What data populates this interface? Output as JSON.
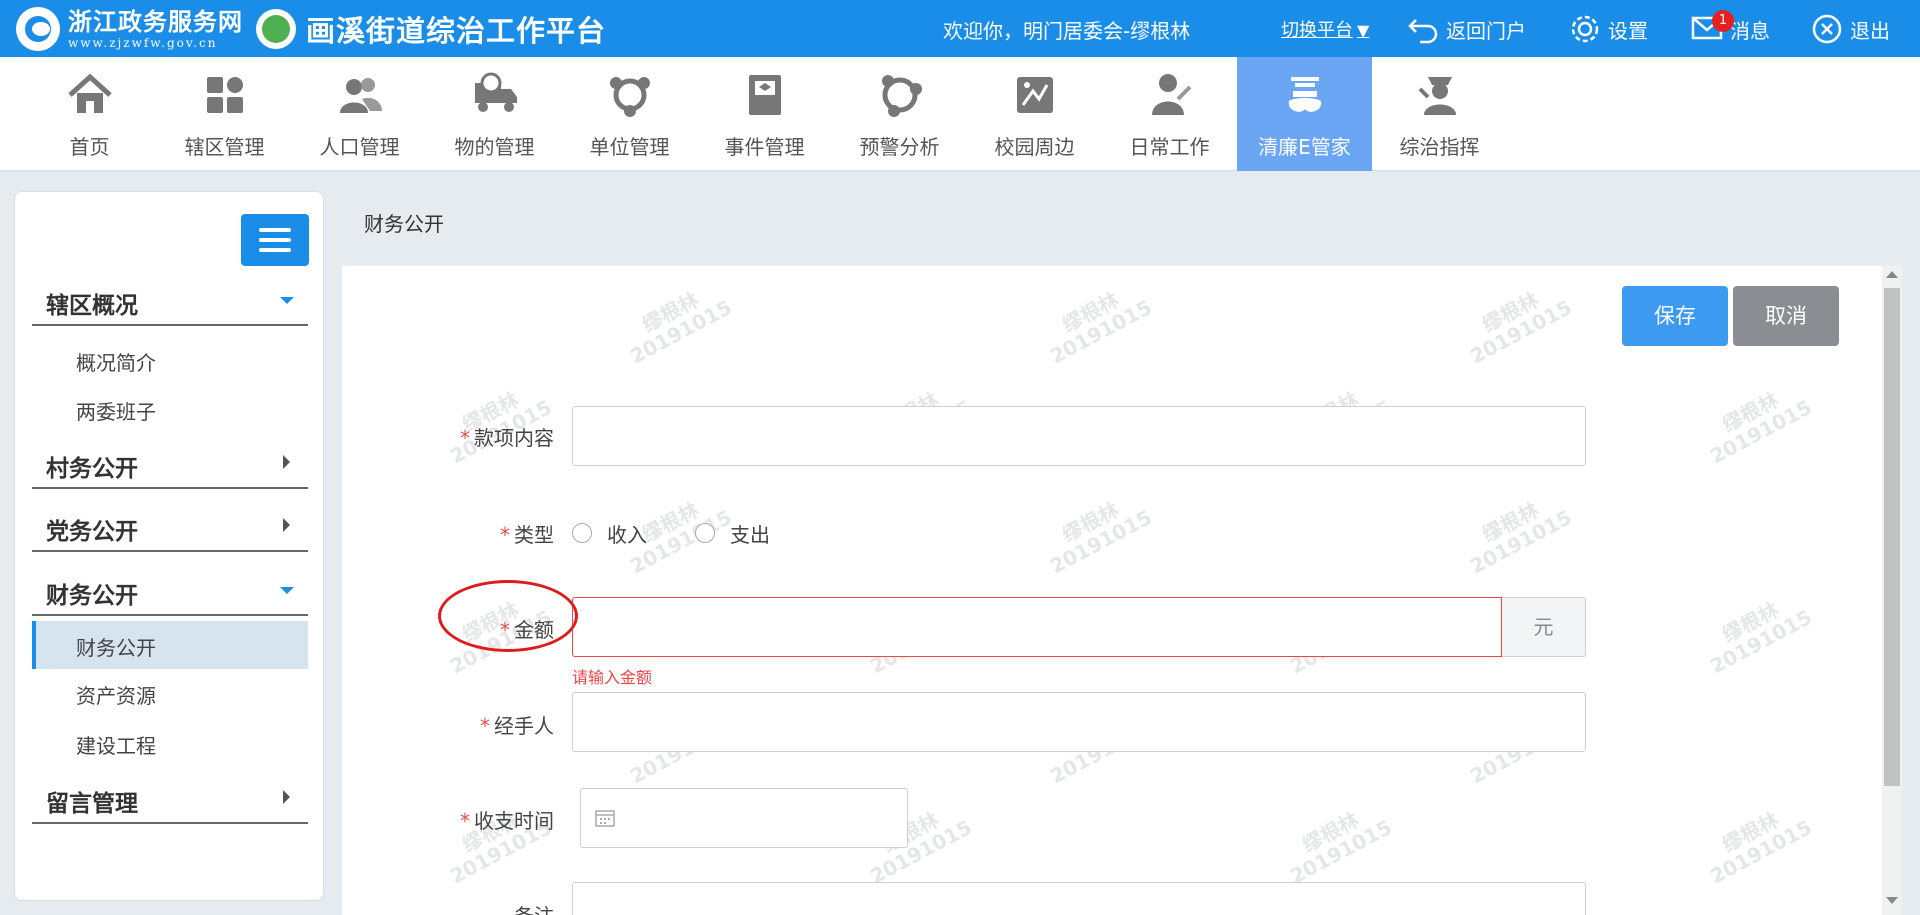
{
  "header": {
    "portal_name": "浙江政务服务网",
    "portal_url": "www.zjzwfw.gov.cn",
    "platform_title": "画溪街道综治工作平台",
    "welcome": "欢迎你，明门居委会-缪根林",
    "switch_platform": "切换平台",
    "switch_arrow": "▼",
    "return_portal": "返回门户",
    "settings": "设置",
    "messages": "消息",
    "message_count": "1",
    "logout": "退出",
    "color": "#1a8de9"
  },
  "nav": {
    "items": [
      {
        "label": "首页",
        "icon": "home-icon"
      },
      {
        "label": "辖区管理",
        "icon": "grid-icon"
      },
      {
        "label": "人口管理",
        "icon": "people-icon"
      },
      {
        "label": "物的管理",
        "icon": "truck-icon"
      },
      {
        "label": "单位管理",
        "icon": "unit-icon"
      },
      {
        "label": "事件管理",
        "icon": "book-icon"
      },
      {
        "label": "预警分析",
        "icon": "network-icon"
      },
      {
        "label": "校园周边",
        "icon": "campus-icon"
      },
      {
        "label": "日常工作",
        "icon": "worker-icon"
      },
      {
        "label": "清廉E管家",
        "icon": "clean-icon",
        "active": true
      },
      {
        "label": "综治指挥",
        "icon": "police-icon"
      }
    ],
    "active_color": "#6aa6f4"
  },
  "sidebar": {
    "sections": [
      {
        "title": "辖区概况",
        "expanded": true,
        "items": [
          "概况简介",
          "两委班子"
        ]
      },
      {
        "title": "村务公开",
        "expanded": false,
        "items": []
      },
      {
        "title": "党务公开",
        "expanded": false,
        "items": []
      },
      {
        "title": "财务公开",
        "expanded": true,
        "items": [
          "财务公开",
          "资产资源",
          "建设工程"
        ],
        "active_item": "财务公开"
      },
      {
        "title": "留言管理",
        "expanded": false,
        "items": []
      }
    ]
  },
  "content": {
    "breadcrumb": "财务公开",
    "watermark_name": "缪根林",
    "watermark_date": "20191015",
    "save_label": "保存",
    "cancel_label": "取消",
    "form": {
      "item_content": {
        "label": "款项内容",
        "required": true,
        "value": ""
      },
      "type": {
        "label": "类型",
        "required": true,
        "options": [
          "收入",
          "支出"
        ],
        "selected": null
      },
      "amount": {
        "label": "金额",
        "required": true,
        "value": "",
        "unit": "元",
        "error": "请输入金额"
      },
      "handler": {
        "label": "经手人",
        "required": true,
        "value": ""
      },
      "time": {
        "label": "收支时间",
        "required": true,
        "value": ""
      },
      "remark": {
        "label": "备注",
        "required": false,
        "value": ""
      }
    },
    "required_mark": "*"
  }
}
